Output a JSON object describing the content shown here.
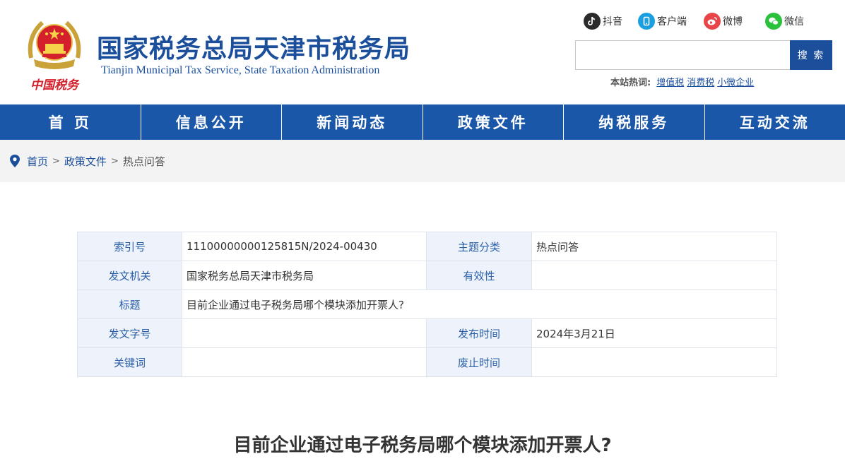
{
  "header": {
    "title": "国家税务总局天津市税务局",
    "subtitle": "Tianjin Municipal Tax Service, State Taxation Administration",
    "emblem_text": "中国税务"
  },
  "social": [
    {
      "label": "抖音",
      "icon": "douyin-icon",
      "color": "#333333"
    },
    {
      "label": "客户端",
      "icon": "mobile-client-icon",
      "color": "#1aa0e0"
    },
    {
      "label": "微博",
      "icon": "weibo-icon",
      "color": "#e8454b"
    },
    {
      "label": "微信",
      "icon": "wechat-icon",
      "color": "#2ac13c"
    }
  ],
  "search": {
    "placeholder": "",
    "button_label": "搜 索"
  },
  "hot": {
    "label": "本站热词:",
    "words": [
      "增值税",
      "消费税",
      "小微企业"
    ]
  },
  "nav": [
    "首 页",
    "信息公开",
    "新闻动态",
    "政策文件",
    "纳税服务",
    "互动交流"
  ],
  "breadcrumb": {
    "home": "首页",
    "section": "政策文件",
    "current": "热点问答",
    "separator": ">"
  },
  "info": {
    "index_label": "索引号",
    "index_value": "11100000000125815N/2024-00430",
    "topic_label": "主题分类",
    "topic_value": "热点问答",
    "issuer_label": "发文机关",
    "issuer_value": "国家税务总局天津市税务局",
    "validity_label": "有效性",
    "validity_value": "",
    "title_label": "标题",
    "title_value": "目前企业通过电子税务局哪个模块添加开票人?",
    "docno_label": "发文字号",
    "docno_value": "",
    "publish_label": "发布时间",
    "publish_value": "2024年3月21日",
    "keyword_label": "关键词",
    "keyword_value": "",
    "expire_label": "废止时间",
    "expire_value": ""
  },
  "article": {
    "title": "目前企业通过电子税务局哪个模块添加开票人?"
  },
  "colors": {
    "brand": "#1b4f9c",
    "nav_bg": "#1b57a9",
    "label_bg": "#eef3fb",
    "crumb_bg": "#f3f3f3"
  }
}
